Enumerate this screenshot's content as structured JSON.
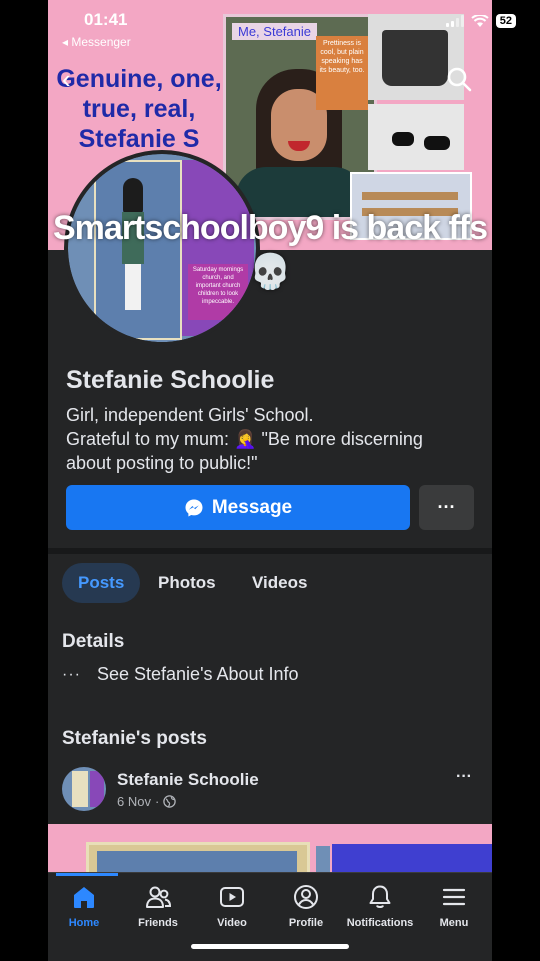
{
  "status_bar": {
    "time": "01:41",
    "back_app": "◂ Messenger",
    "battery": "52"
  },
  "cover": {
    "left_text": "Genuine, one, true, real, Stefanie S",
    "photo_tag": "Me, Stefanie",
    "note_text": "Prettiness is cool, but plain speaking has its beauty, too."
  },
  "avatar": {
    "note_text": "Saturday mornings church, and important church children to look impeccable."
  },
  "overlay_caption": "Smartschoolboy9 is back ffs 💀",
  "profile": {
    "name": "Stefanie Schoolie",
    "bio_line1": "Girl, independent Girls' School.",
    "bio_line2": "Grateful to my mum: 🤦‍♀️ \"Be more discerning",
    "bio_line3": "about posting to public!\""
  },
  "actions": {
    "message_label": "Message",
    "more_label": "···"
  },
  "tabs": [
    {
      "label": "Posts"
    },
    {
      "label": "Photos"
    },
    {
      "label": "Videos"
    }
  ],
  "details": {
    "title": "Details",
    "about_dots": "···",
    "about_label": "See Stefanie's About Info"
  },
  "posts": {
    "title": "Stefanie's posts",
    "first_post": {
      "author": "Stefanie Schoolie",
      "date": "6 Nov",
      "separator": "·",
      "more": "···"
    }
  },
  "nav": [
    {
      "label": "Home",
      "icon": "home-icon"
    },
    {
      "label": "Friends",
      "icon": "friends-icon"
    },
    {
      "label": "Video",
      "icon": "video-icon"
    },
    {
      "label": "Profile",
      "icon": "profile-icon"
    },
    {
      "label": "Notifications",
      "icon": "bell-icon"
    },
    {
      "label": "Menu",
      "icon": "menu-icon"
    }
  ],
  "colors": {
    "accent": "#1877f2",
    "active_tab_bg": "#263951",
    "active_tab_text": "#4599ff",
    "nav_active": "#2d88ff",
    "background": "#242526"
  }
}
